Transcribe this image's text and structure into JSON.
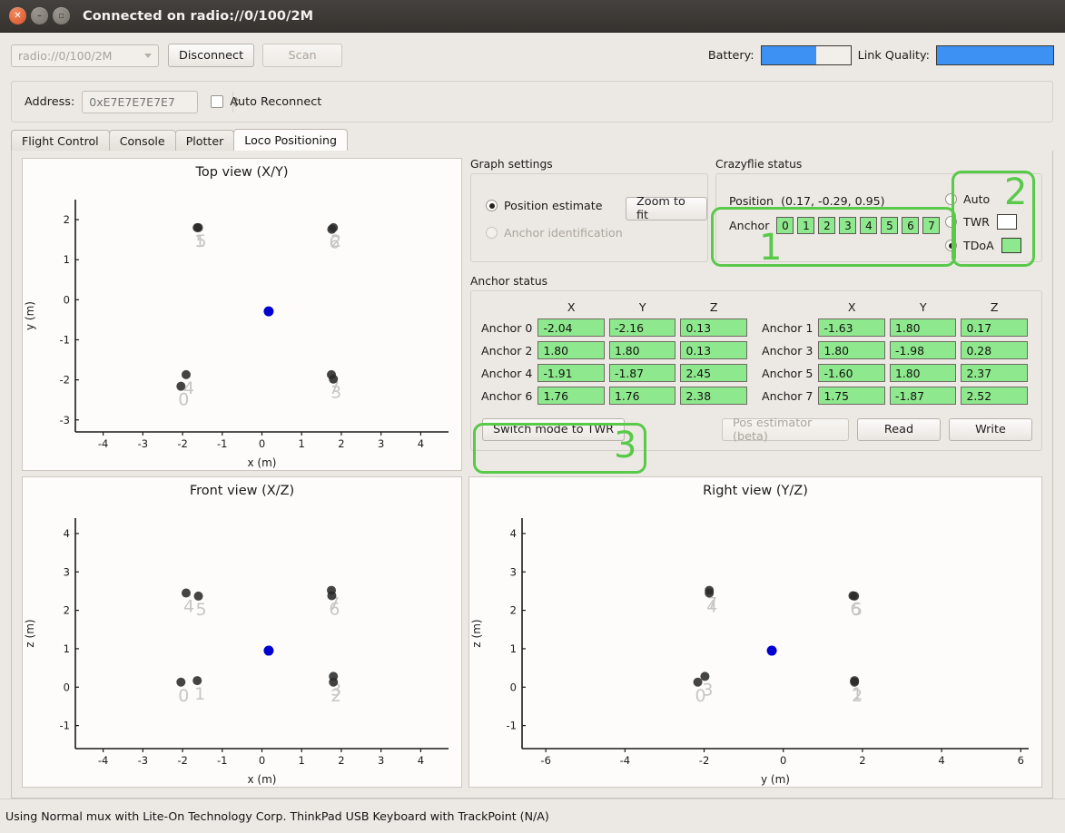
{
  "window": {
    "title": "Connected on radio://0/100/2M",
    "close_icon": "close-icon",
    "minimize_icon": "minimize-icon",
    "maximize_icon": "maximize-icon"
  },
  "toolbar": {
    "uri_value": "radio://0/100/2M",
    "disconnect_label": "Disconnect",
    "scan_label": "Scan",
    "battery_label": "Battery:",
    "link_quality_label": "Link Quality:",
    "battery_percent": 62,
    "link_quality_percent": 100,
    "accent_color": "#3c91f2"
  },
  "address_row": {
    "label": "Address:",
    "value": "0xE7E7E7E7E7",
    "auto_reconnect_label": "Auto Reconnect",
    "auto_reconnect_checked": false
  },
  "tabs": [
    {
      "label": "Flight Control",
      "active": false
    },
    {
      "label": "Console",
      "active": false
    },
    {
      "label": "Plotter",
      "active": false
    },
    {
      "label": "Loco Positioning",
      "active": true
    }
  ],
  "graph_settings": {
    "title": "Graph settings",
    "position_estimate_label": "Position estimate",
    "position_estimate_selected": true,
    "anchor_identification_label": "Anchor identification",
    "anchor_identification_selected": false,
    "anchor_identification_disabled": true,
    "zoom_to_fit_label": "Zoom to fit"
  },
  "crazyflie_status": {
    "title": "Crazyflie status",
    "position_label": "Position",
    "position_value": "(0.17, -0.29, 0.95)",
    "anchor_label": "Anchor",
    "anchor_chips": [
      "0",
      "1",
      "2",
      "3",
      "4",
      "5",
      "6",
      "7"
    ],
    "chip_color": "#8ee88e",
    "modes": [
      {
        "label": "Auto",
        "selected": false,
        "swatch": null
      },
      {
        "label": "TWR",
        "selected": false,
        "swatch": "#ffffff"
      },
      {
        "label": "TDoA",
        "selected": true,
        "swatch": "#8ee88e"
      }
    ]
  },
  "anchor_status": {
    "title": "Anchor status",
    "columns": [
      "X",
      "Y",
      "Z"
    ],
    "rows": [
      {
        "left_name": "Anchor 0",
        "left": [
          "-2.04",
          "-2.16",
          "0.13"
        ],
        "right_name": "Anchor 1",
        "right": [
          "-1.63",
          "1.80",
          "0.17"
        ]
      },
      {
        "left_name": "Anchor 2",
        "left": [
          "1.80",
          "1.80",
          "0.13"
        ],
        "right_name": "Anchor 3",
        "right": [
          "1.80",
          "-1.98",
          "0.28"
        ]
      },
      {
        "left_name": "Anchor 4",
        "left": [
          "-1.91",
          "-1.87",
          "2.45"
        ],
        "right_name": "Anchor 5",
        "right": [
          "-1.60",
          "1.80",
          "2.37"
        ]
      },
      {
        "left_name": "Anchor 6",
        "left": [
          "1.76",
          "1.76",
          "2.38"
        ],
        "right_name": "Anchor 7",
        "right": [
          "1.75",
          "-1.87",
          "2.52"
        ]
      }
    ],
    "switch_mode_label": "Switch mode to TWR",
    "pos_estimator_label": "Pos estimator (beta)",
    "pos_estimator_disabled": true,
    "read_label": "Read",
    "write_label": "Write"
  },
  "annotations": [
    {
      "id": "1",
      "label": "1",
      "color": "#59c94a"
    },
    {
      "id": "2",
      "label": "2",
      "color": "#59c94a"
    },
    {
      "id": "3",
      "label": "3",
      "color": "#59c94a"
    }
  ],
  "statusbar": {
    "text": "Using Normal mux with Lite-On Technology Corp. ThinkPad USB Keyboard with TrackPoint (N/A)"
  },
  "chart_data": [
    {
      "type": "scatter",
      "name": "top-view",
      "title": "Top view (X/Y)",
      "xlabel": "x (m)",
      "ylabel": "y (m)",
      "xlim": [
        -4.7,
        4.7
      ],
      "ylim": [
        -3.3,
        2.5
      ],
      "xticks": [
        -4,
        -3,
        -2,
        -1,
        0,
        1,
        2,
        3,
        4
      ],
      "yticks": [
        -3,
        -2,
        -1,
        0,
        1,
        2
      ],
      "grid": false,
      "anchors": [
        {
          "id": "0",
          "x": -2.04,
          "y": -2.16
        },
        {
          "id": "1",
          "x": -1.63,
          "y": 1.8
        },
        {
          "id": "2",
          "x": 1.8,
          "y": 1.8
        },
        {
          "id": "3",
          "x": 1.8,
          "y": -1.98
        },
        {
          "id": "4",
          "x": -1.91,
          "y": -1.87
        },
        {
          "id": "5",
          "x": -1.6,
          "y": 1.8
        },
        {
          "id": "6",
          "x": 1.76,
          "y": 1.76
        },
        {
          "id": "7",
          "x": 1.75,
          "y": -1.87
        }
      ],
      "position": {
        "x": 0.17,
        "y": -0.29,
        "color": "#0000d0"
      },
      "anchor_color": "#2a2a2a",
      "label_color": "#c6c6c6"
    },
    {
      "type": "scatter",
      "name": "front-view",
      "title": "Front view (X/Z)",
      "xlabel": "x (m)",
      "ylabel": "z (m)",
      "xlim": [
        -4.7,
        4.7
      ],
      "ylim": [
        -1.6,
        4.4
      ],
      "xticks": [
        -4,
        -3,
        -2,
        -1,
        0,
        1,
        2,
        3,
        4
      ],
      "yticks": [
        -1,
        0,
        1,
        2,
        3,
        4
      ],
      "grid": false,
      "anchors": [
        {
          "id": "0",
          "x": -2.04,
          "y": 0.13
        },
        {
          "id": "1",
          "x": -1.63,
          "y": 0.17
        },
        {
          "id": "2",
          "x": 1.8,
          "y": 0.13
        },
        {
          "id": "3",
          "x": 1.8,
          "y": 0.28
        },
        {
          "id": "4",
          "x": -1.91,
          "y": 2.45
        },
        {
          "id": "5",
          "x": -1.6,
          "y": 2.37
        },
        {
          "id": "6",
          "x": 1.76,
          "y": 2.38
        },
        {
          "id": "7",
          "x": 1.75,
          "y": 2.52
        }
      ],
      "position": {
        "x": 0.17,
        "y": 0.95,
        "color": "#0000d0"
      },
      "anchor_color": "#2a2a2a",
      "label_color": "#c6c6c6"
    },
    {
      "type": "scatter",
      "name": "right-view",
      "title": "Right view (Y/Z)",
      "xlabel": "y (m)",
      "ylabel": "z (m)",
      "xlim": [
        -6.6,
        6.2
      ],
      "ylim": [
        -1.6,
        4.4
      ],
      "xticks": [
        -6,
        -4,
        -2,
        0,
        2,
        4,
        6
      ],
      "yticks": [
        -1,
        0,
        1,
        2,
        3,
        4
      ],
      "grid": false,
      "anchors": [
        {
          "id": "0",
          "x": -2.16,
          "y": 0.13
        },
        {
          "id": "1",
          "x": 1.8,
          "y": 0.17
        },
        {
          "id": "2",
          "x": 1.8,
          "y": 0.13
        },
        {
          "id": "3",
          "x": -1.98,
          "y": 0.28
        },
        {
          "id": "4",
          "x": -1.87,
          "y": 2.45
        },
        {
          "id": "5",
          "x": 1.8,
          "y": 2.37
        },
        {
          "id": "6",
          "x": 1.76,
          "y": 2.38
        },
        {
          "id": "7",
          "x": -1.87,
          "y": 2.52
        }
      ],
      "position": {
        "x": -0.29,
        "y": 0.95,
        "color": "#0000d0"
      },
      "anchor_color": "#2a2a2a",
      "label_color": "#c6c6c6"
    }
  ]
}
